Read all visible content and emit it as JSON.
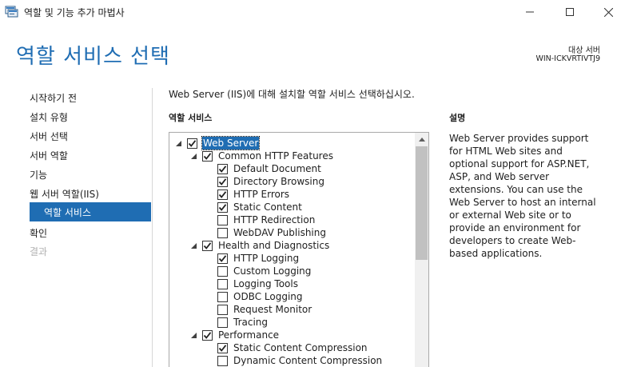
{
  "window": {
    "title": "역할 및 기능 추가 마법사"
  },
  "header": {
    "page_title": "역할 서비스 선택",
    "target_label": "대상 서버",
    "target_server": "WIN-ICKVRTIVTJ9"
  },
  "nav": {
    "items": [
      {
        "label": "시작하기 전",
        "state": "normal"
      },
      {
        "label": "설치 유형",
        "state": "normal"
      },
      {
        "label": "서버 선택",
        "state": "normal"
      },
      {
        "label": "서버 역할",
        "state": "normal"
      },
      {
        "label": "기능",
        "state": "normal"
      },
      {
        "label": "웹 서버 역할(IIS)",
        "state": "normal"
      },
      {
        "label": "역할 서비스",
        "state": "selected"
      },
      {
        "label": "확인",
        "state": "normal"
      },
      {
        "label": "결과",
        "state": "disabled"
      }
    ]
  },
  "content": {
    "instruction": "Web Server (IIS)에 대해 설치할 역할 서비스 선택하십시오.",
    "section_label": "역할 서비스",
    "description_label": "설명",
    "description_text": "Web Server provides support for HTML Web sites and optional support for ASP.NET, ASP, and Web server extensions. You can use the Web Server to host an internal or external Web site or to provide an environment for developers to create Web-based applications."
  },
  "tree": {
    "items": [
      {
        "label": "Web Server",
        "level": 0,
        "checked": true,
        "expanded": true,
        "selected": true
      },
      {
        "label": "Common HTTP Features",
        "level": 1,
        "checked": true,
        "expanded": true
      },
      {
        "label": "Default Document",
        "level": 2,
        "checked": true
      },
      {
        "label": "Directory Browsing",
        "level": 2,
        "checked": true
      },
      {
        "label": "HTTP Errors",
        "level": 2,
        "checked": true
      },
      {
        "label": "Static Content",
        "level": 2,
        "checked": true
      },
      {
        "label": "HTTP Redirection",
        "level": 2,
        "checked": false
      },
      {
        "label": "WebDAV Publishing",
        "level": 2,
        "checked": false
      },
      {
        "label": "Health and Diagnostics",
        "level": 1,
        "checked": true,
        "expanded": true
      },
      {
        "label": "HTTP Logging",
        "level": 2,
        "checked": true
      },
      {
        "label": "Custom Logging",
        "level": 2,
        "checked": false
      },
      {
        "label": "Logging Tools",
        "level": 2,
        "checked": false
      },
      {
        "label": "ODBC Logging",
        "level": 2,
        "checked": false
      },
      {
        "label": "Request Monitor",
        "level": 2,
        "checked": false
      },
      {
        "label": "Tracing",
        "level": 2,
        "checked": false
      },
      {
        "label": "Performance",
        "level": 1,
        "checked": true,
        "expanded": true
      },
      {
        "label": "Static Content Compression",
        "level": 2,
        "checked": true
      },
      {
        "label": "Dynamic Content Compression",
        "level": 2,
        "checked": false
      }
    ]
  },
  "colors": {
    "accent": "#1f6db3",
    "disabled_text": "#b0b0b0"
  }
}
